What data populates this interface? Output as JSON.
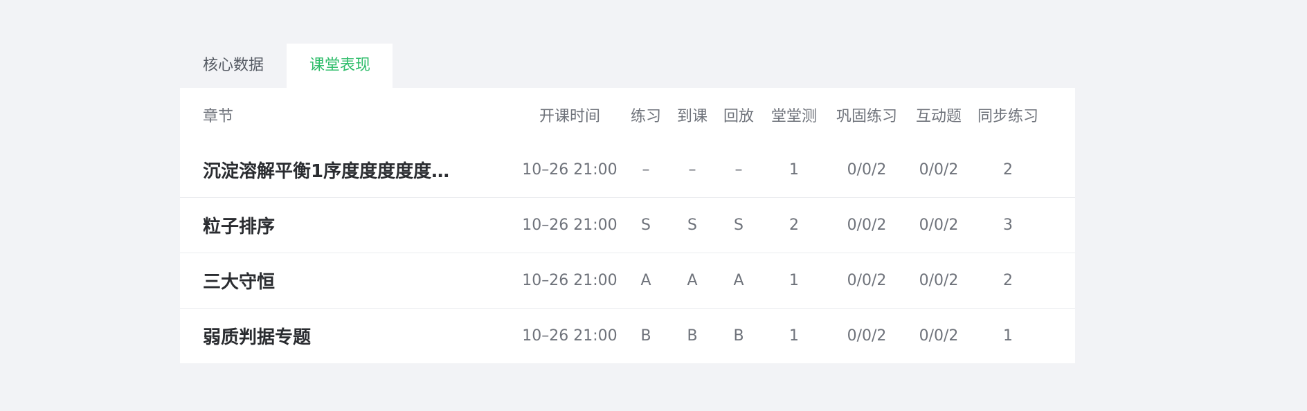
{
  "tabs": [
    {
      "label": "核心数据",
      "active": false
    },
    {
      "label": "课堂表现",
      "active": true
    }
  ],
  "colors": {
    "accent_green": "#2ebd6a",
    "ratio_orange": "#f28c12",
    "page_bg": "#f2f3f6"
  },
  "table": {
    "headers": {
      "chapter": "章节",
      "time": "开课时间",
      "exercise": "练习",
      "attendance": "到课",
      "replay": "回放",
      "quiz": "堂堂测",
      "consolidate": "巩固练习",
      "interactive": "互动题",
      "sync": "同步练习"
    },
    "rows": [
      {
        "chapter": "沉淀溶解平衡1序度度度度度…",
        "time": "10–26 21:00",
        "exercise": "–",
        "attendance": "–",
        "replay": "–",
        "quiz": "1",
        "consolidate": "0/0/2",
        "interactive": "0/0/2",
        "sync": "2"
      },
      {
        "chapter": "粒子排序",
        "time": "10–26 21:00",
        "exercise": "S",
        "attendance": "S",
        "replay": "S",
        "quiz": "2",
        "consolidate": "0/0/2",
        "interactive": "0/0/2",
        "sync": "3"
      },
      {
        "chapter": "三大守恒",
        "time": "10–26 21:00",
        "exercise": "A",
        "attendance": "A",
        "replay": "A",
        "quiz": "1",
        "consolidate": "0/0/2",
        "interactive": "0/0/2",
        "sync": "2"
      },
      {
        "chapter": "弱质判据专题",
        "time": "10–26 21:00",
        "exercise": "B",
        "attendance": "B",
        "replay": "B",
        "quiz": "1",
        "consolidate": "0/0/2",
        "interactive": "0/0/2",
        "sync": "1"
      }
    ]
  }
}
